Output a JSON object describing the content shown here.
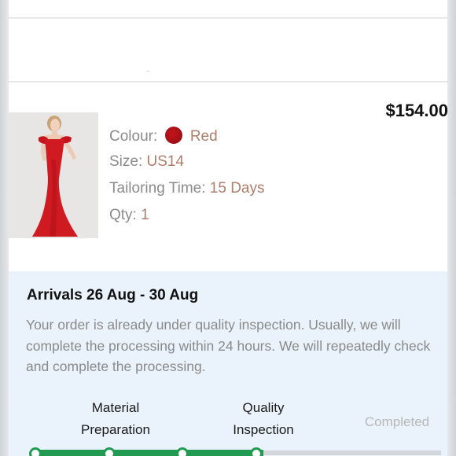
{
  "product": {
    "price": "$154.00",
    "image_alt": "red off-shoulder mermaid gown",
    "colour_label": "Colour:",
    "colour_value": "Red",
    "colour_swatch": "#c4141c",
    "size_label": "Size:",
    "size_value": "US14",
    "tailoring_label": "Tailoring Time:",
    "tailoring_value": "15 Days",
    "qty_label": "Qty:",
    "qty_value": "1"
  },
  "shipping": {
    "arrivals": "Arrivals 26 Aug - 30 Aug",
    "message": "Your order is already under quality inspection. Usually, we will complete the processing within 24 hours. We will repeatedly check and complete the processing.",
    "steps": [
      {
        "line1": "Material",
        "line2": "Preparation"
      },
      {
        "line1": "Quality",
        "line2": "Inspection"
      },
      {
        "line1": "Completed",
        "line2": ""
      }
    ]
  },
  "colors": {
    "accent_value": "#b07d6b",
    "progress_green": "#219a52",
    "info_background": "#eaf2fb"
  }
}
